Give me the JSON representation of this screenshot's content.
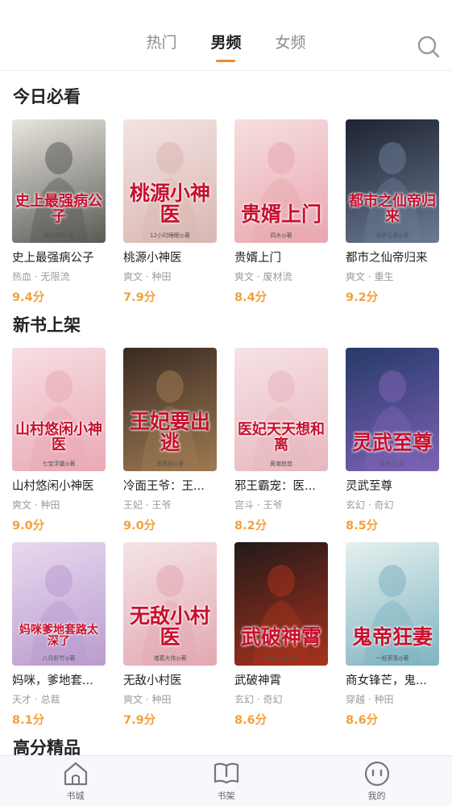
{
  "tabs": [
    {
      "label": "热门"
    },
    {
      "label": "男频"
    },
    {
      "label": "女频"
    }
  ],
  "sections": [
    {
      "title": "今日必看",
      "books": [
        {
          "name": "史上最强病公子",
          "tags": "热血 · 无限流",
          "score": "9.4分",
          "cover_title": "史上最强病公子",
          "cover_author": "夏日蝉鸣/著",
          "cover_bg": "#e9e6df",
          "cover_accent": "#5a5a55"
        },
        {
          "name": "桃源小神医",
          "tags": "爽文 · 种田",
          "score": "7.9分",
          "cover_title": "桃源小神医",
          "cover_author": "12小时睡眠◎著",
          "cover_bg": "#f3e3e2",
          "cover_accent": "#d9b7b2"
        },
        {
          "name": "贵婿上门",
          "tags": "爽文 · 废材流",
          "score": "8.4分",
          "cover_title": "贵婿上门",
          "cover_author": "四木◎著",
          "cover_bg": "#f6dedf",
          "cover_accent": "#e8a7b0"
        },
        {
          "name": "都市之仙帝归来",
          "tags": "爽文 · 重生",
          "score": "9.2分",
          "cover_title": "都市之仙帝归来",
          "cover_author": "候梦无事◎著",
          "cover_bg": "#1d2330",
          "cover_accent": "#6b7a93"
        }
      ]
    },
    {
      "title": "新书上架",
      "books": [
        {
          "name": "山村悠闲小神医",
          "tags": "爽文 · 种田",
          "score": "9.0分",
          "cover_title": "山村悠闲小神医",
          "cover_author": "七宝浮屠◎著",
          "cover_bg": "#f7dfe2",
          "cover_accent": "#e9a9b5"
        },
        {
          "name": "冷面王爷：王...",
          "tags": "王妃 · 王爷",
          "score": "9.0分",
          "cover_title": "王妃要出逃",
          "cover_author": "蛋黄酥◎著",
          "cover_bg": "#3a2a22",
          "cover_accent": "#9e7a52"
        },
        {
          "name": "邪王霸宠：医...",
          "tags": "宫斗 · 王爷",
          "score": "8.2分",
          "cover_title": "医妃天天想和离",
          "cover_author": "黄瀚悠悠",
          "cover_bg": "#f6e2e4",
          "cover_accent": "#e7b7bf"
        },
        {
          "name": "灵武至尊",
          "tags": "玄幻 · 奇幻",
          "score": "8.5分",
          "cover_title": "灵武至尊",
          "cover_author": "孙大王/文",
          "cover_bg": "#263a69",
          "cover_accent": "#7d63b5"
        }
      ]
    },
    {
      "title": "",
      "books": [
        {
          "name": "妈咪，爹地套...",
          "tags": "天才 · 总裁",
          "score": "8.1分",
          "cover_title": "妈咪爹地套路太深了",
          "cover_author": "八月折竹◎著",
          "cover_bg": "#e7d9ee",
          "cover_accent": "#b99ccf"
        },
        {
          "name": "无敌小村医",
          "tags": "爽文 · 种田",
          "score": "7.9分",
          "cover_title": "无敌小村医",
          "cover_author": "诸葛大伟◎著",
          "cover_bg": "#f4e4e6",
          "cover_accent": "#e2a8b2"
        },
        {
          "name": "武破神霄",
          "tags": "玄幻 · 奇幻",
          "score": "8.6分",
          "cover_title": "武破神霄",
          "cover_author": "作者：殇川至",
          "cover_bg": "#221a1a",
          "cover_accent": "#a8321c"
        },
        {
          "name": "商女锋芒，鬼...",
          "tags": "穿越 · 种田",
          "score": "8.6分",
          "cover_title": "鬼帝狂妻",
          "cover_author": "一纸荼笺◎著",
          "cover_bg": "#e5f1ee",
          "cover_accent": "#7fb3c2"
        }
      ]
    }
  ],
  "next_section_title": "高分精品",
  "bottom_nav": [
    {
      "label": "书城"
    },
    {
      "label": "书架"
    },
    {
      "label": "我的"
    }
  ],
  "colors": {
    "accent": "#f08a24",
    "score": "#f0a23b",
    "tags": "#9b9b9b"
  }
}
